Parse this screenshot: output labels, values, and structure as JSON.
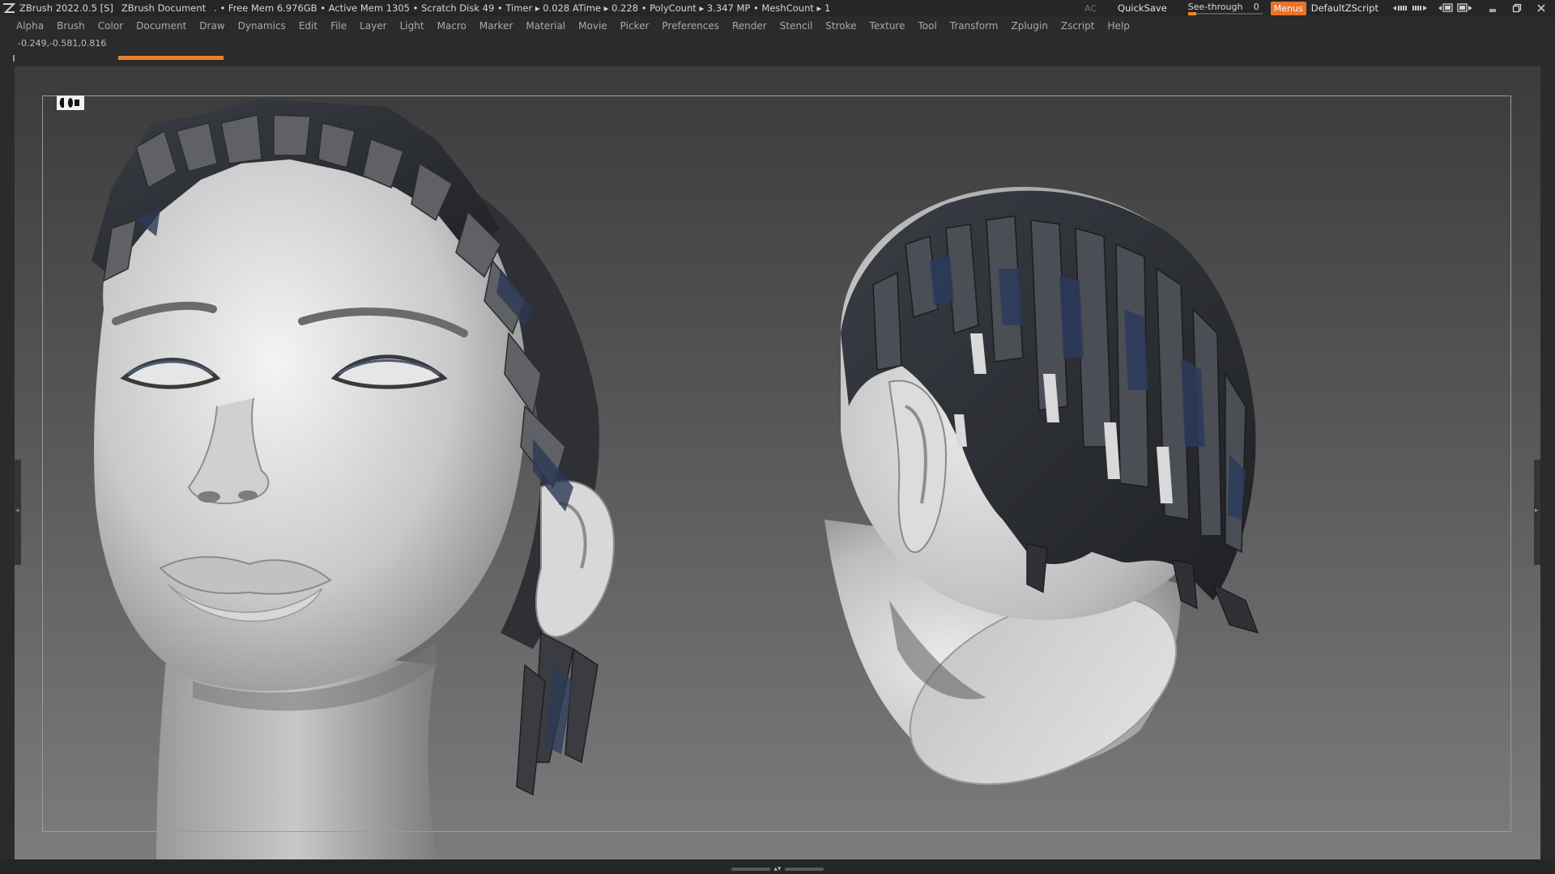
{
  "titlebar": {
    "app_title": "ZBrush 2022.0.5 [S]",
    "document": "ZBrush Document",
    "stats": ". • Free Mem 6.976GB • Active Mem 1305 • Scratch Disk 49 • Timer ▸ 0.028 ATime ▸ 0.228 • PolyCount ▸ 3.347 MP • MeshCount ▸ 1",
    "ac_label": "AC",
    "quicksave_label": "QuickSave",
    "seethrough_label": "See-through",
    "seethrough_value": "0",
    "menus_label": "Menus",
    "script_label": "DefaultZScript",
    "accent_color": "#e8732a"
  },
  "menubar": {
    "items": [
      "Alpha",
      "Brush",
      "Color",
      "Document",
      "Draw",
      "Dynamics",
      "Edit",
      "File",
      "Layer",
      "Light",
      "Macro",
      "Marker",
      "Material",
      "Movie",
      "Picker",
      "Preferences",
      "Render",
      "Stencil",
      "Stroke",
      "Texture",
      "Tool",
      "Transform",
      "Zplugin",
      "Zscript",
      "Help"
    ]
  },
  "status": {
    "coords": "-0.249,-0.581,0.816"
  },
  "icons": {
    "logo": "zbrush-logo-icon",
    "perspective": "perspective-toggle-icon",
    "window_controls": [
      "layout-left-icon",
      "layout-right-icon",
      "popup-icon",
      "dock-icon",
      "minimize-icon",
      "restore-icon",
      "close-icon"
    ]
  }
}
